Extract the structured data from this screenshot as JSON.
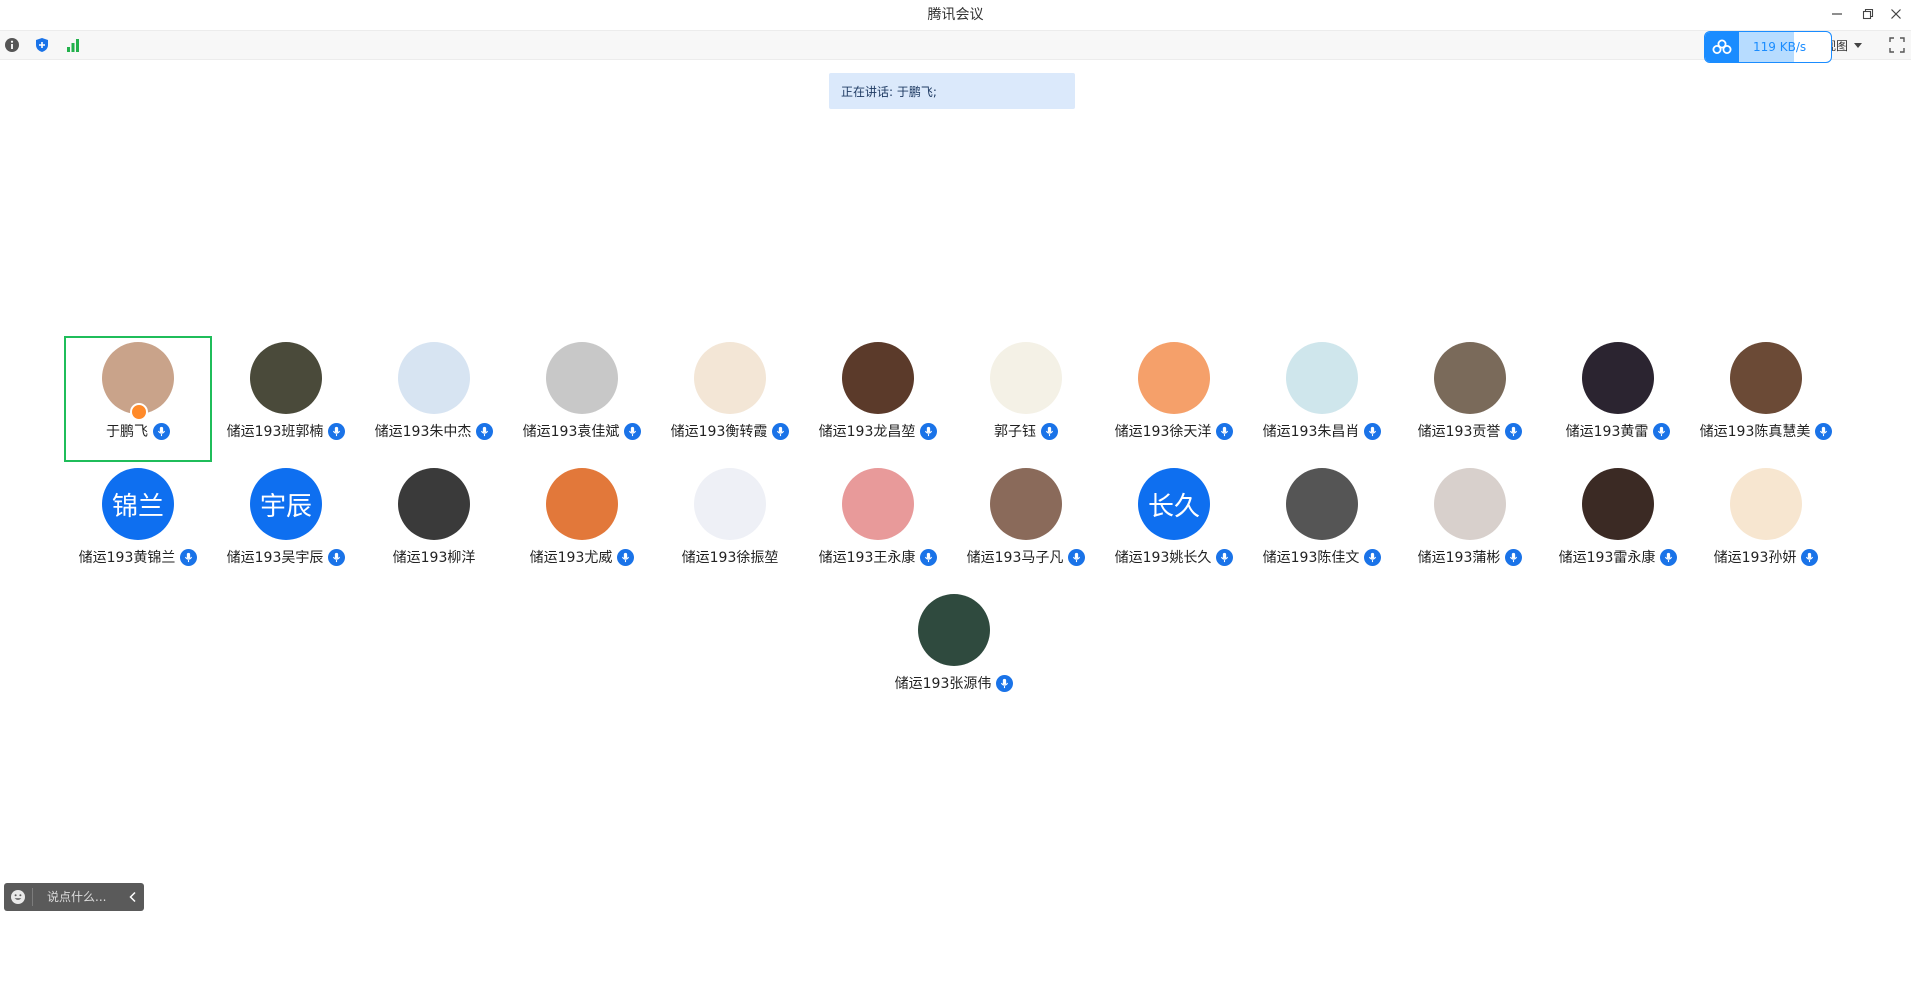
{
  "window": {
    "title": "腾讯会议",
    "minimize_label": "—",
    "restore_label": "⧉",
    "close_label": "✕"
  },
  "toolbar": {
    "view_label": "视图",
    "info_icon": "info-icon",
    "shield_icon": "shield-icon",
    "signal_icon": "signal-icon",
    "fullscreen_icon": "fullscreen-icon"
  },
  "network": {
    "speed_label": "119 KB/s",
    "fill_percent": 60,
    "accent": "#1a8cff"
  },
  "speaking": {
    "text": "正在讲话: 于鹏飞;"
  },
  "participants": [
    {
      "name": "于鹏飞",
      "active": true,
      "host": true,
      "mic": true,
      "avatar_color": "#c9a38a"
    },
    {
      "name": "储运193班郭楠",
      "mic": true,
      "avatar_color": "#4a4a3a"
    },
    {
      "name": "储运193朱中杰",
      "mic": true,
      "avatar_color": "#d7e4f2"
    },
    {
      "name": "储运193袁佳斌",
      "mic": true,
      "avatar_color": "#c8c8c8"
    },
    {
      "name": "储运193衡转霞",
      "mic": true,
      "avatar_color": "#f3e6d6"
    },
    {
      "name": "储运193龙昌堃",
      "mic": true,
      "avatar_color": "#5b3a2a"
    },
    {
      "name": "郭子钰",
      "mic": true,
      "avatar_color": "#f4f1e6"
    },
    {
      "name": "储运193徐天洋",
      "mic": true,
      "avatar_color": "#f5a06a"
    },
    {
      "name": "储运193朱昌肖",
      "mic": true,
      "avatar_color": "#cfe6ec"
    },
    {
      "name": "储运193贡誉",
      "mic": true,
      "avatar_color": "#7a6a5a"
    },
    {
      "name": "储运193黄雷",
      "mic": true,
      "avatar_color": "#2b2430"
    },
    {
      "name": "储运193陈真慧美",
      "mic": true,
      "avatar_color": "#6b4a36"
    },
    {
      "name": "储运193黄锦兰",
      "mic": true,
      "avatar_color": "#0e6ff0",
      "avatar_text": "锦兰"
    },
    {
      "name": "储运193吴宇辰",
      "mic": true,
      "avatar_color": "#0e6ff0",
      "avatar_text": "宇辰"
    },
    {
      "name": "储运193柳洋",
      "mic": false,
      "avatar_color": "#3a3a3a"
    },
    {
      "name": "储运193尤威",
      "mic": true,
      "avatar_color": "#e2783a"
    },
    {
      "name": "储运193徐振堃",
      "mic": false,
      "avatar_color": "#eef0f6"
    },
    {
      "name": "储运193王永康",
      "mic": true,
      "avatar_color": "#e89a9a"
    },
    {
      "name": "储运193马子凡",
      "mic": true,
      "avatar_color": "#8a6a5a"
    },
    {
      "name": "储运193姚长久",
      "mic": true,
      "avatar_color": "#0e6ff0",
      "avatar_text": "长久"
    },
    {
      "name": "储运193陈佳文",
      "mic": true,
      "avatar_color": "#555555"
    },
    {
      "name": "储运193蒲彬",
      "mic": true,
      "avatar_color": "#d8d0cc"
    },
    {
      "name": "储运193雷永康",
      "mic": true,
      "avatar_color": "#3b2a24"
    },
    {
      "name": "储运193孙妍",
      "mic": true,
      "avatar_color": "#f7e6d0"
    },
    {
      "name": "储运193张源伟",
      "mic": true,
      "avatar_color": "#2f4a3e"
    }
  ],
  "chat": {
    "placeholder": "说点什么...",
    "emoji_icon": "smiley-icon",
    "collapse_icon": "chevron-left-icon"
  }
}
